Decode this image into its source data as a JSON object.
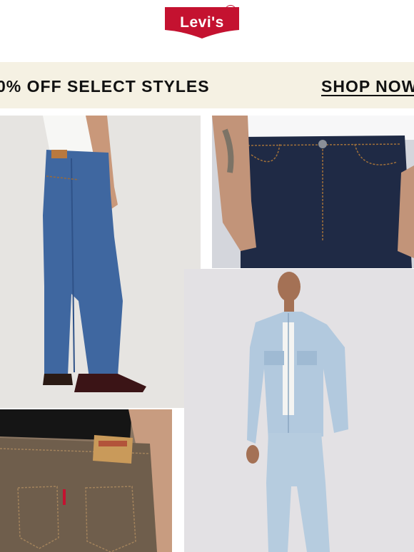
{
  "brand": {
    "logo_text": "Levi's",
    "registered_mark": "R",
    "brand_color": "#c41230"
  },
  "promo_banner": {
    "headline": "0% OFF SELECT STYLES",
    "cta_label": "SHOP NOW",
    "background_color": "#f5f1e3"
  },
  "images": [
    {
      "name": "jeans-side-view-image",
      "description": "model wearing medium-wash straight jeans with burgundy loafers"
    },
    {
      "name": "jeans-front-detail-image",
      "description": "close-up of dark raw denim jeans front with button fly"
    },
    {
      "name": "denim-jacket-outfit-image",
      "description": "model in light-wash denim trucker jacket and matching jeans"
    },
    {
      "name": "jeans-back-pocket-image",
      "description": "close-up of brown overdyed jeans back pocket with leather patch"
    }
  ]
}
